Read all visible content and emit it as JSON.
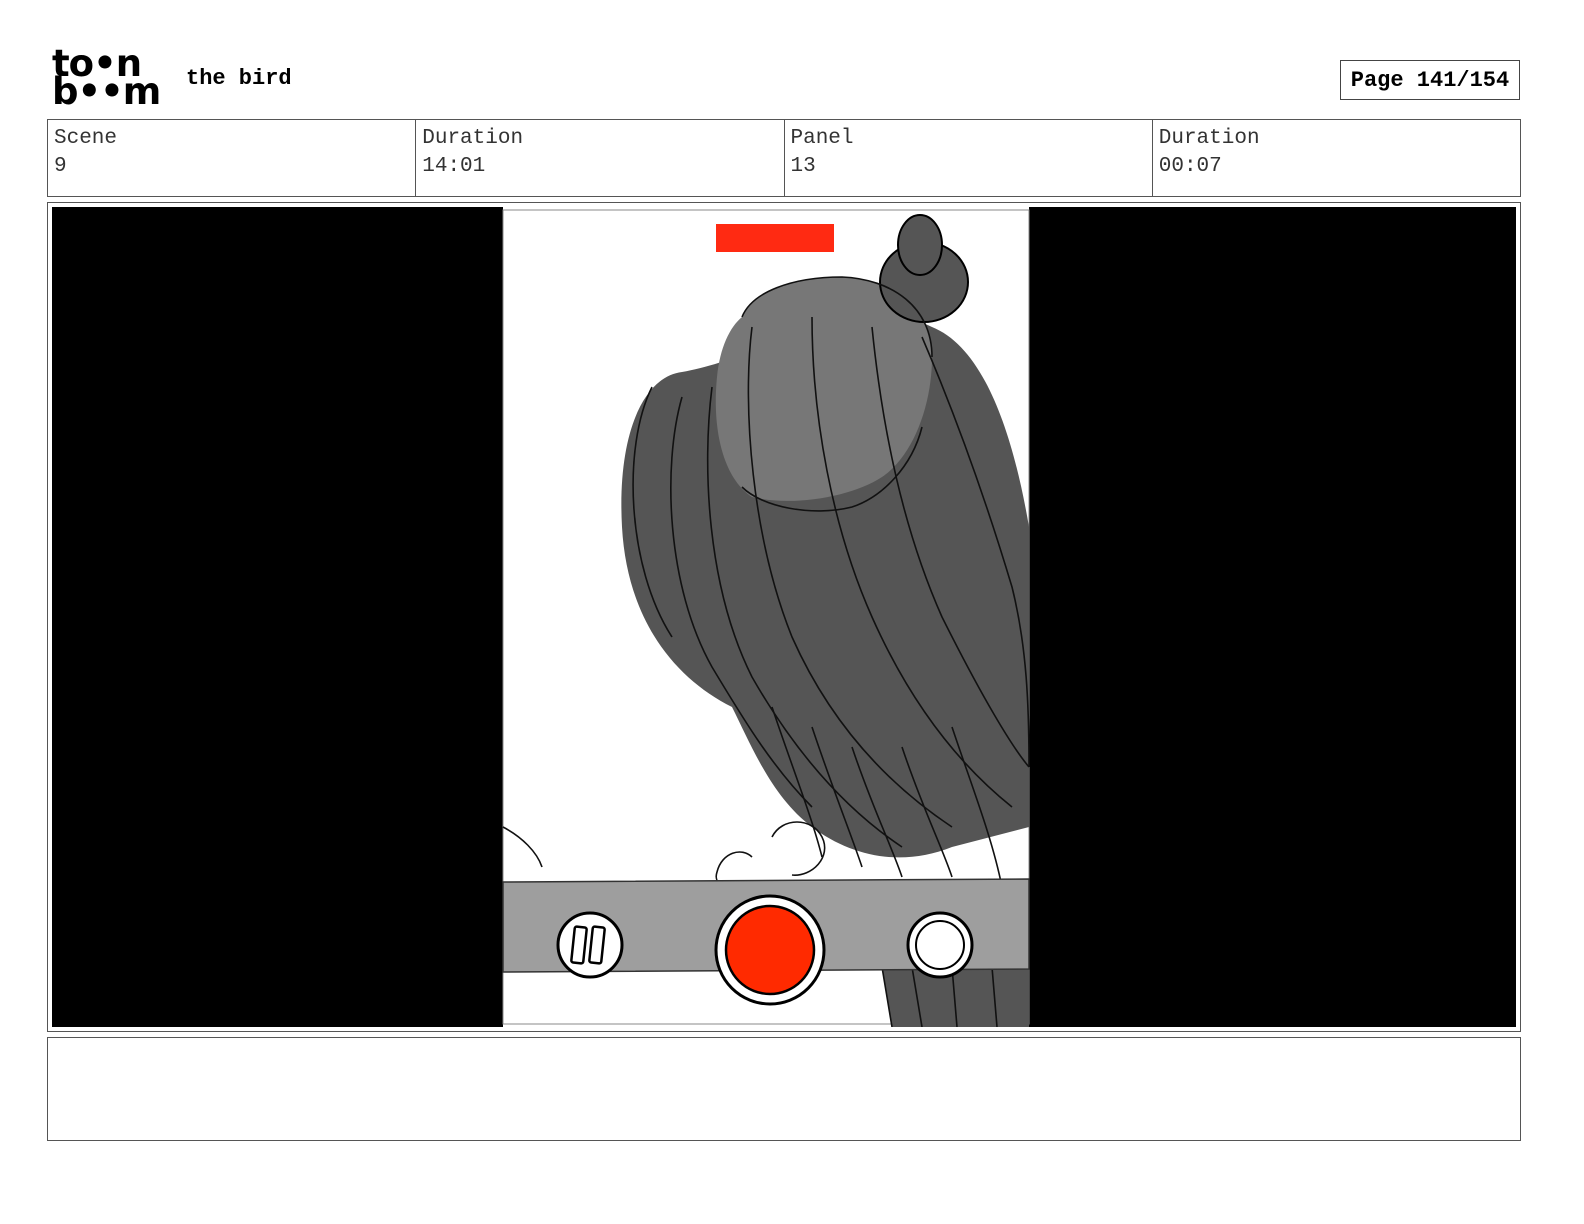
{
  "header": {
    "logo": {
      "line1": "to•n",
      "line2": "b••m"
    },
    "project_title": "the bird",
    "page_label": "Page 141/154"
  },
  "info": {
    "scene_label": "Scene",
    "scene_value": "9",
    "scene_duration_label": "Duration",
    "scene_duration_value": "14:01",
    "panel_label": "Panel",
    "panel_value": "13",
    "panel_duration_label": "Duration",
    "panel_duration_value": "00:07"
  },
  "panel_image": {
    "subject": "sketch of a bird perched on a ledge seen through a phone camera recording screen",
    "recording_indicator_color": "#ff2a12",
    "record_button_color": "#ff2a00"
  },
  "notes": {
    "text": ""
  }
}
